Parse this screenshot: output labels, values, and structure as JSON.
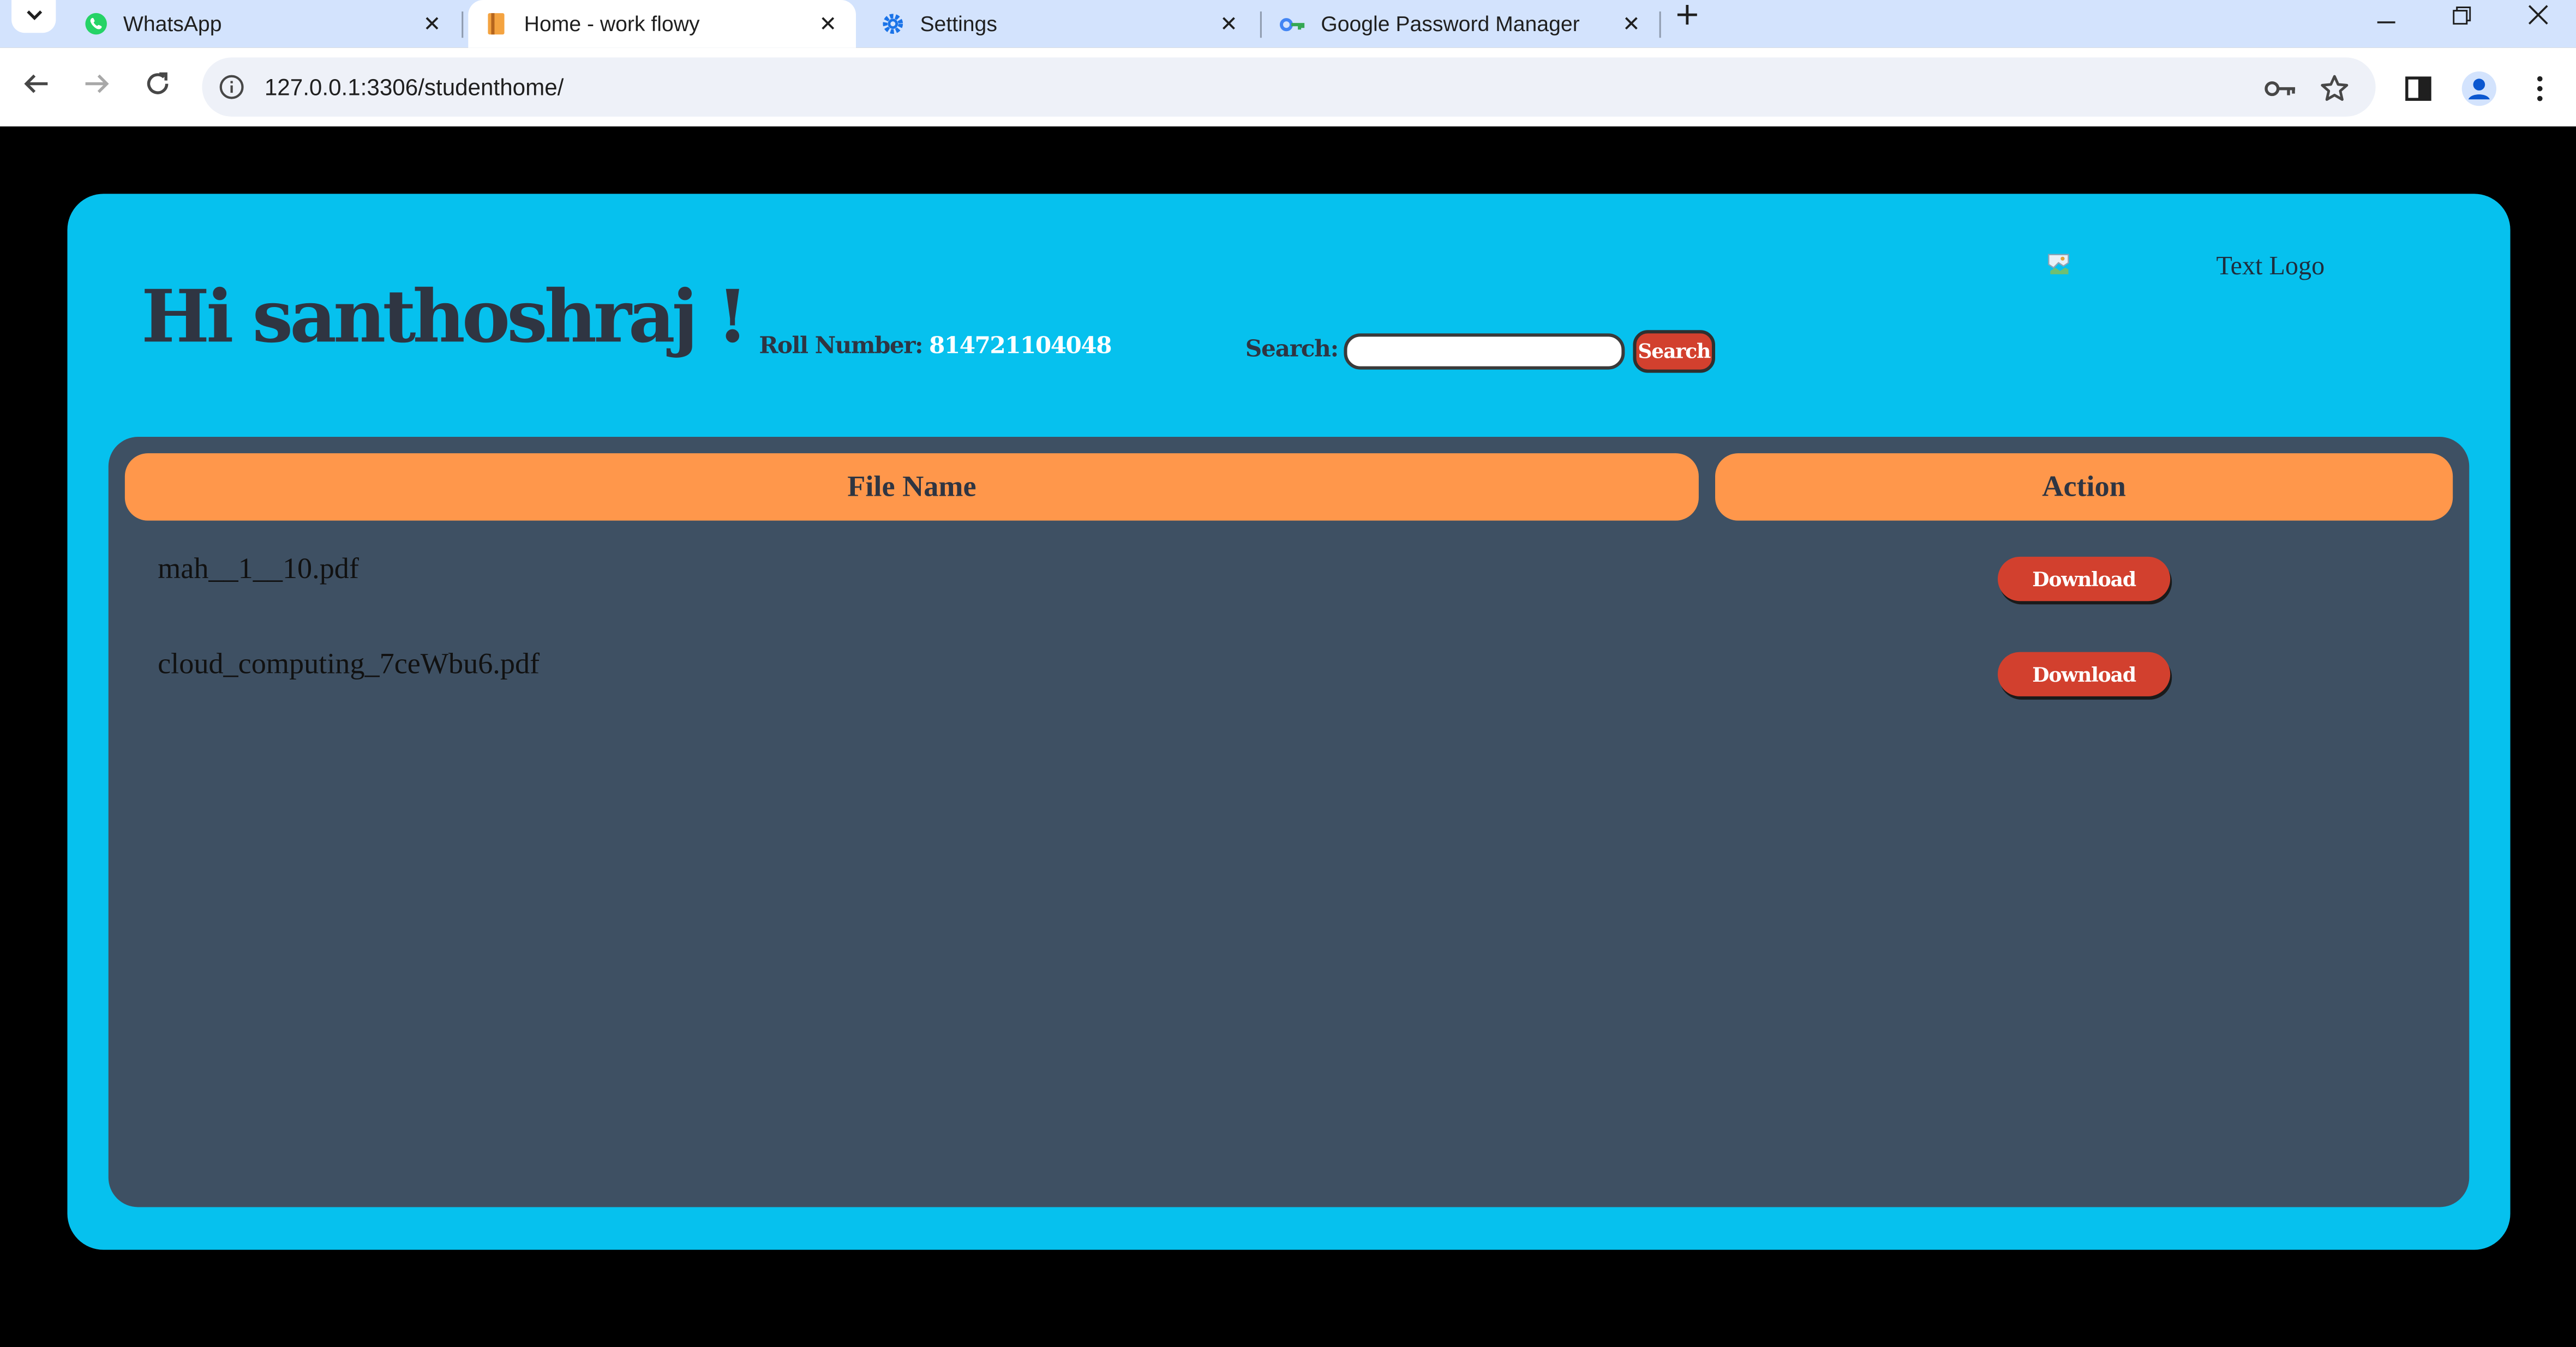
{
  "browser": {
    "tabs": [
      {
        "title": "WhatsApp",
        "icon": "whatsapp-icon",
        "active": false
      },
      {
        "title": "Home - work flowy",
        "icon": "book-icon",
        "active": true
      },
      {
        "title": "Settings",
        "icon": "gear-icon",
        "active": false
      },
      {
        "title": "Google Password Manager",
        "icon": "key-icon",
        "active": false
      }
    ],
    "url": "127.0.0.1:3306/studenthome/"
  },
  "page": {
    "greeting": "Hi santhoshraj !",
    "roll_label": "Roll Number:",
    "roll_value": "814721104048",
    "search_label": "Search:",
    "search_value": "",
    "search_button": "Search",
    "logo_alt": "Text Logo",
    "table": {
      "headers": [
        "File Name",
        "Action"
      ],
      "rows": [
        {
          "file": "mah__1__10.pdf",
          "action": "Download"
        },
        {
          "file": "cloud_computing_7ceWbu6.pdf",
          "action": "Download"
        }
      ]
    }
  },
  "colors": {
    "background": "#000000",
    "card": "#06c1ee",
    "panel": "#3e5063",
    "header_cells": "#ff974b",
    "button": "#d2402e",
    "heading_text": "#2f3542"
  }
}
